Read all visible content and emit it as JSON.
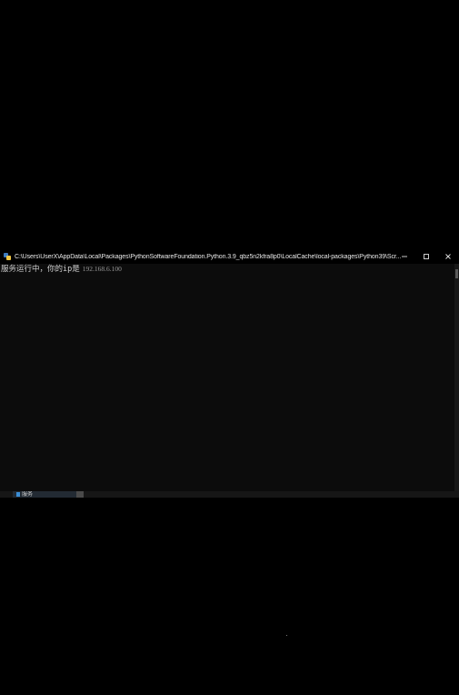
{
  "window": {
    "title": "C:\\Users\\UserX\\AppData\\Local\\Packages\\PythonSoftwareFoundation.Python.3.9_qbz5n2kfra8p0\\LocalCache\\local-packages\\Python39\\Scr...",
    "controls": {
      "minimize": "—",
      "maximize": "☐",
      "close": "✕"
    }
  },
  "console": {
    "line1_prefix": "服务运行中，你的ip是",
    "line1_ip": "192.168.6.100"
  },
  "taskbar": {
    "item_label": "服务"
  },
  "colors": {
    "background": "#000000",
    "console_bg": "#0c0c0c",
    "text": "#cccccc"
  }
}
